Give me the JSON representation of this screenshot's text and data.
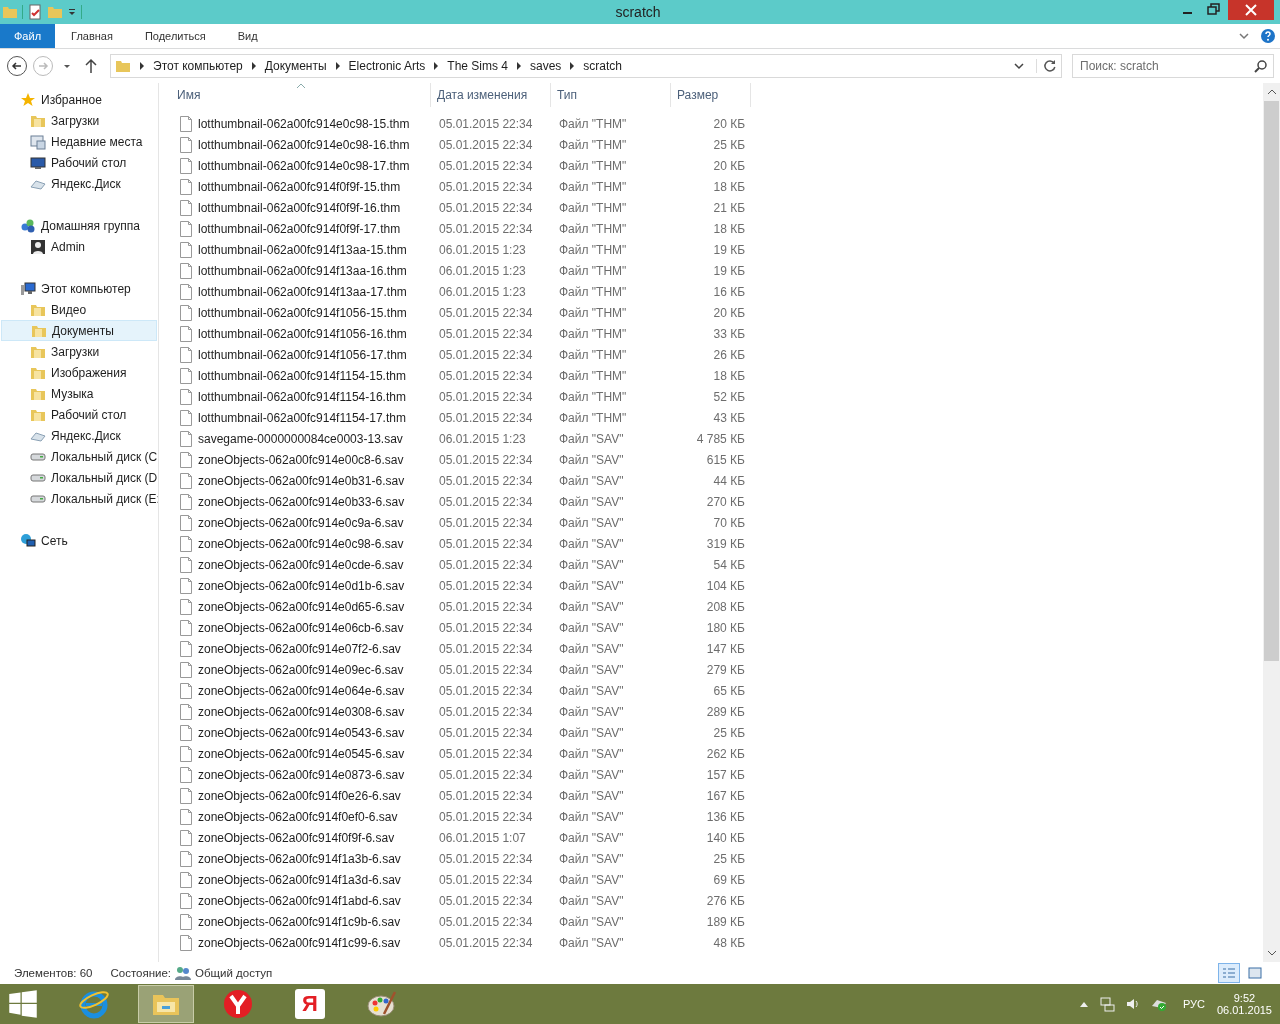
{
  "window": {
    "title": "scratch"
  },
  "ribbon": {
    "tabs": [
      {
        "label": "Файл",
        "kind": "file"
      },
      {
        "label": "Главная",
        "kind": "tab"
      },
      {
        "label": "Поделиться",
        "kind": "tab"
      },
      {
        "label": "Вид",
        "kind": "tab"
      }
    ]
  },
  "address_bar": {
    "forward_disabled": true,
    "path": [
      "Этот компьютер",
      "Документы",
      "Electronic Arts",
      "The Sims 4",
      "saves",
      "scratch"
    ]
  },
  "search": {
    "placeholder": "Поиск: scratch"
  },
  "sidebar": {
    "items": [
      {
        "label": "Избранное",
        "kind": "star",
        "selected": false,
        "children": [
          {
            "label": "Загрузки",
            "kind": "folder",
            "selected": false
          },
          {
            "label": "Недавние места",
            "kind": "recent",
            "selected": false
          },
          {
            "label": "Рабочий стол",
            "kind": "monitor",
            "selected": false
          },
          {
            "label": "Яндекс.Диск",
            "kind": "cloud",
            "selected": false
          }
        ]
      },
      {
        "label": "Домашняя группа",
        "kind": "homegroup",
        "selected": false,
        "children": [
          {
            "label": "Admin",
            "kind": "user",
            "selected": false
          }
        ]
      },
      {
        "label": "Этот компьютер",
        "kind": "computer",
        "selected": false,
        "children": [
          {
            "label": "Видео",
            "kind": "folder",
            "selected": false
          },
          {
            "label": "Документы",
            "kind": "folder",
            "selected": true
          },
          {
            "label": "Загрузки",
            "kind": "folder",
            "selected": false
          },
          {
            "label": "Изображения",
            "kind": "folder",
            "selected": false
          },
          {
            "label": "Музыка",
            "kind": "folder",
            "selected": false
          },
          {
            "label": "Рабочий стол",
            "kind": "folder",
            "selected": false
          },
          {
            "label": "Яндекс.Диск",
            "kind": "cloud",
            "selected": false
          },
          {
            "label": "Локальный диск (C",
            "kind": "drive",
            "selected": false
          },
          {
            "label": "Локальный диск (D",
            "kind": "drive",
            "selected": false
          },
          {
            "label": "Локальный диск (E:",
            "kind": "drive",
            "selected": false
          }
        ]
      },
      {
        "label": "Сеть",
        "kind": "network",
        "selected": false
      }
    ]
  },
  "table": {
    "columns": [
      {
        "label": "Имя",
        "sorted": true
      },
      {
        "label": "Дата изменения",
        "sorted": false
      },
      {
        "label": "Тип",
        "sorted": false
      },
      {
        "label": "Размер",
        "sorted": false
      }
    ],
    "rows": [
      {
        "name": "lotthumbnail-062a00fc914e0c98-15.thm",
        "modified": "05.01.2015 22:34",
        "type": "Файл \"THM\"",
        "size": "20 КБ"
      },
      {
        "name": "lotthumbnail-062a00fc914e0c98-16.thm",
        "modified": "05.01.2015 22:34",
        "type": "Файл \"THM\"",
        "size": "25 КБ"
      },
      {
        "name": "lotthumbnail-062a00fc914e0c98-17.thm",
        "modified": "05.01.2015 22:34",
        "type": "Файл \"THM\"",
        "size": "20 КБ"
      },
      {
        "name": "lotthumbnail-062a00fc914f0f9f-15.thm",
        "modified": "05.01.2015 22:34",
        "type": "Файл \"THM\"",
        "size": "18 КБ"
      },
      {
        "name": "lotthumbnail-062a00fc914f0f9f-16.thm",
        "modified": "05.01.2015 22:34",
        "type": "Файл \"THM\"",
        "size": "21 КБ"
      },
      {
        "name": "lotthumbnail-062a00fc914f0f9f-17.thm",
        "modified": "05.01.2015 22:34",
        "type": "Файл \"THM\"",
        "size": "18 КБ"
      },
      {
        "name": "lotthumbnail-062a00fc914f13aa-15.thm",
        "modified": "06.01.2015 1:23",
        "type": "Файл \"THM\"",
        "size": "19 КБ"
      },
      {
        "name": "lotthumbnail-062a00fc914f13aa-16.thm",
        "modified": "06.01.2015 1:23",
        "type": "Файл \"THM\"",
        "size": "19 КБ"
      },
      {
        "name": "lotthumbnail-062a00fc914f13aa-17.thm",
        "modified": "06.01.2015 1:23",
        "type": "Файл \"THM\"",
        "size": "16 КБ"
      },
      {
        "name": "lotthumbnail-062a00fc914f1056-15.thm",
        "modified": "05.01.2015 22:34",
        "type": "Файл \"THM\"",
        "size": "20 КБ"
      },
      {
        "name": "lotthumbnail-062a00fc914f1056-16.thm",
        "modified": "05.01.2015 22:34",
        "type": "Файл \"THM\"",
        "size": "33 КБ"
      },
      {
        "name": "lotthumbnail-062a00fc914f1056-17.thm",
        "modified": "05.01.2015 22:34",
        "type": "Файл \"THM\"",
        "size": "26 КБ"
      },
      {
        "name": "lotthumbnail-062a00fc914f1154-15.thm",
        "modified": "05.01.2015 22:34",
        "type": "Файл \"THM\"",
        "size": "18 КБ"
      },
      {
        "name": "lotthumbnail-062a00fc914f1154-16.thm",
        "modified": "05.01.2015 22:34",
        "type": "Файл \"THM\"",
        "size": "52 КБ"
      },
      {
        "name": "lotthumbnail-062a00fc914f1154-17.thm",
        "modified": "05.01.2015 22:34",
        "type": "Файл \"THM\"",
        "size": "43 КБ"
      },
      {
        "name": "savegame-0000000084ce0003-13.sav",
        "modified": "06.01.2015 1:23",
        "type": "Файл \"SAV\"",
        "size": "4 785 КБ"
      },
      {
        "name": "zoneObjects-062a00fc914e00c8-6.sav",
        "modified": "05.01.2015 22:34",
        "type": "Файл \"SAV\"",
        "size": "615 КБ"
      },
      {
        "name": "zoneObjects-062a00fc914e0b31-6.sav",
        "modified": "05.01.2015 22:34",
        "type": "Файл \"SAV\"",
        "size": "44 КБ"
      },
      {
        "name": "zoneObjects-062a00fc914e0b33-6.sav",
        "modified": "05.01.2015 22:34",
        "type": "Файл \"SAV\"",
        "size": "270 КБ"
      },
      {
        "name": "zoneObjects-062a00fc914e0c9a-6.sav",
        "modified": "05.01.2015 22:34",
        "type": "Файл \"SAV\"",
        "size": "70 КБ"
      },
      {
        "name": "zoneObjects-062a00fc914e0c98-6.sav",
        "modified": "05.01.2015 22:34",
        "type": "Файл \"SAV\"",
        "size": "319 КБ"
      },
      {
        "name": "zoneObjects-062a00fc914e0cde-6.sav",
        "modified": "05.01.2015 22:34",
        "type": "Файл \"SAV\"",
        "size": "54 КБ"
      },
      {
        "name": "zoneObjects-062a00fc914e0d1b-6.sav",
        "modified": "05.01.2015 22:34",
        "type": "Файл \"SAV\"",
        "size": "104 КБ"
      },
      {
        "name": "zoneObjects-062a00fc914e0d65-6.sav",
        "modified": "05.01.2015 22:34",
        "type": "Файл \"SAV\"",
        "size": "208 КБ"
      },
      {
        "name": "zoneObjects-062a00fc914e06cb-6.sav",
        "modified": "05.01.2015 22:34",
        "type": "Файл \"SAV\"",
        "size": "180 КБ"
      },
      {
        "name": "zoneObjects-062a00fc914e07f2-6.sav",
        "modified": "05.01.2015 22:34",
        "type": "Файл \"SAV\"",
        "size": "147 КБ"
      },
      {
        "name": "zoneObjects-062a00fc914e09ec-6.sav",
        "modified": "05.01.2015 22:34",
        "type": "Файл \"SAV\"",
        "size": "279 КБ"
      },
      {
        "name": "zoneObjects-062a00fc914e064e-6.sav",
        "modified": "05.01.2015 22:34",
        "type": "Файл \"SAV\"",
        "size": "65 КБ"
      },
      {
        "name": "zoneObjects-062a00fc914e0308-6.sav",
        "modified": "05.01.2015 22:34",
        "type": "Файл \"SAV\"",
        "size": "289 КБ"
      },
      {
        "name": "zoneObjects-062a00fc914e0543-6.sav",
        "modified": "05.01.2015 22:34",
        "type": "Файл \"SAV\"",
        "size": "25 КБ"
      },
      {
        "name": "zoneObjects-062a00fc914e0545-6.sav",
        "modified": "05.01.2015 22:34",
        "type": "Файл \"SAV\"",
        "size": "262 КБ"
      },
      {
        "name": "zoneObjects-062a00fc914e0873-6.sav",
        "modified": "05.01.2015 22:34",
        "type": "Файл \"SAV\"",
        "size": "157 КБ"
      },
      {
        "name": "zoneObjects-062a00fc914f0e26-6.sav",
        "modified": "05.01.2015 22:34",
        "type": "Файл \"SAV\"",
        "size": "167 КБ"
      },
      {
        "name": "zoneObjects-062a00fc914f0ef0-6.sav",
        "modified": "05.01.2015 22:34",
        "type": "Файл \"SAV\"",
        "size": "136 КБ"
      },
      {
        "name": "zoneObjects-062a00fc914f0f9f-6.sav",
        "modified": "06.01.2015 1:07",
        "type": "Файл \"SAV\"",
        "size": "140 КБ"
      },
      {
        "name": "zoneObjects-062a00fc914f1a3b-6.sav",
        "modified": "05.01.2015 22:34",
        "type": "Файл \"SAV\"",
        "size": "25 КБ"
      },
      {
        "name": "zoneObjects-062a00fc914f1a3d-6.sav",
        "modified": "05.01.2015 22:34",
        "type": "Файл \"SAV\"",
        "size": "69 КБ"
      },
      {
        "name": "zoneObjects-062a00fc914f1abd-6.sav",
        "modified": "05.01.2015 22:34",
        "type": "Файл \"SAV\"",
        "size": "276 КБ"
      },
      {
        "name": "zoneObjects-062a00fc914f1c9b-6.sav",
        "modified": "05.01.2015 22:34",
        "type": "Файл \"SAV\"",
        "size": "189 КБ"
      },
      {
        "name": "zoneObjects-062a00fc914f1c99-6.sav",
        "modified": "05.01.2015 22:34",
        "type": "Файл \"SAV\"",
        "size": "48 КБ"
      }
    ]
  },
  "status_bar": {
    "count": "Элементов: 60",
    "state_label": "Состояние:",
    "state_value": "Общий доступ",
    "views": [
      {
        "kind": "details",
        "selected": true
      },
      {
        "kind": "icons",
        "selected": false
      }
    ]
  },
  "taskbar": {
    "apps": [
      {
        "kind": "browser-e",
        "selected": false
      },
      {
        "kind": "explorer",
        "selected": true
      },
      {
        "kind": "red-browser",
        "selected": false
      },
      {
        "kind": "letter",
        "label": "Я",
        "selected": false
      },
      {
        "kind": "paint",
        "selected": false
      }
    ],
    "language": "РУС",
    "time": "9:52",
    "date": "06.01.2015"
  }
}
